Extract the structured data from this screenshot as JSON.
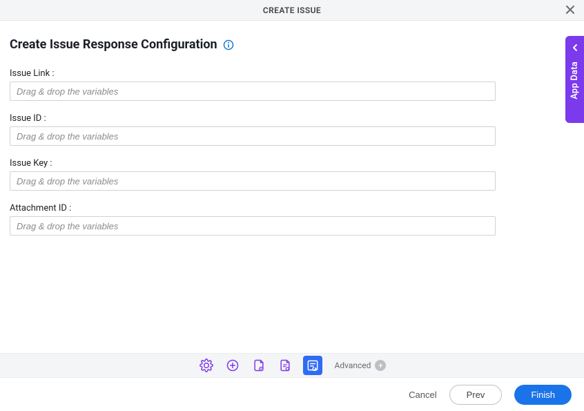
{
  "header": {
    "title": "CREATE ISSUE"
  },
  "section": {
    "title": "Create Issue Response Configuration"
  },
  "fields": [
    {
      "label": "Issue Link :",
      "placeholder": "Drag & drop the variables"
    },
    {
      "label": "Issue ID :",
      "placeholder": "Drag & drop the variables"
    },
    {
      "label": "Issue Key :",
      "placeholder": "Drag & drop the variables"
    },
    {
      "label": "Attachment ID :",
      "placeholder": "Drag & drop the variables"
    }
  ],
  "sideTab": {
    "label": "App Data"
  },
  "stepBar": {
    "advanced": "Advanced"
  },
  "footer": {
    "cancel": "Cancel",
    "prev": "Prev",
    "finish": "Finish"
  }
}
